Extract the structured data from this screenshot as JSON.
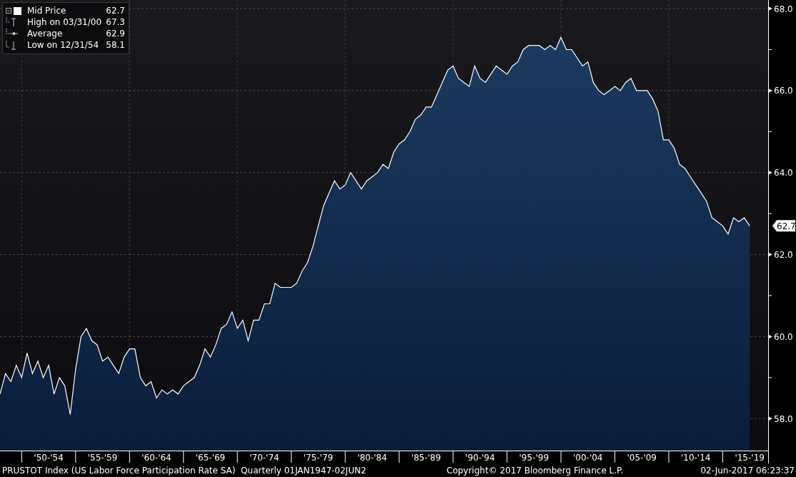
{
  "chart": {
    "legend": [
      {
        "kind": "series",
        "label": "Mid Price",
        "value": "62.7"
      },
      {
        "kind": "high",
        "label": "High on 03/31/00",
        "value": "67.3"
      },
      {
        "kind": "average",
        "label": "Average",
        "value": "62.9"
      },
      {
        "kind": "low",
        "label": "Low on 12/31/54",
        "value": "58.1"
      }
    ],
    "last_value_tag": "62.7",
    "chart_data": {
      "type": "area",
      "grid": true,
      "ylim": [
        57.22,
        68.21
      ],
      "yticks": [
        {
          "value": 58,
          "label": "58.0"
        },
        {
          "value": 60,
          "label": "60.0"
        },
        {
          "value": 62,
          "label": "62.0"
        },
        {
          "value": 64,
          "label": "64.0"
        },
        {
          "value": 66,
          "label": "66.0"
        },
        {
          "value": 68,
          "label": "68.0"
        }
      ],
      "categories": [
        null,
        null,
        null,
        null,
        null,
        null,
        null,
        null,
        null,
        "'50-'54",
        null,
        null,
        null,
        null,
        null,
        null,
        null,
        null,
        null,
        "'55-'59",
        null,
        null,
        null,
        null,
        null,
        null,
        null,
        null,
        null,
        "'60-'64",
        null,
        null,
        null,
        null,
        null,
        null,
        null,
        null,
        null,
        "'65-'69",
        null,
        null,
        null,
        null,
        null,
        null,
        null,
        null,
        null,
        "'70-'74",
        null,
        null,
        null,
        null,
        null,
        null,
        null,
        null,
        null,
        "'75-'79",
        null,
        null,
        null,
        null,
        null,
        null,
        null,
        null,
        null,
        "'80-'84",
        null,
        null,
        null,
        null,
        null,
        null,
        null,
        null,
        null,
        "'85-'89",
        null,
        null,
        null,
        null,
        null,
        null,
        null,
        null,
        null,
        "'90-'94",
        null,
        null,
        null,
        null,
        null,
        null,
        null,
        null,
        null,
        "'95-'99",
        null,
        null,
        null,
        null,
        null,
        null,
        null,
        null,
        null,
        "'00-'04",
        null,
        null,
        null,
        null,
        null,
        null,
        null,
        null,
        null,
        "'05-'09",
        null,
        null,
        null,
        null,
        null,
        null,
        null,
        null,
        null,
        "'10-'14",
        null,
        null,
        null,
        null,
        null,
        null,
        null,
        null,
        null,
        "'15-'19"
      ],
      "series": [
        {
          "color": "#ffffff",
          "values": [
            58.6,
            59.1,
            58.9,
            59.3,
            59.0,
            59.6,
            59.1,
            59.4,
            59.0,
            59.3,
            58.6,
            59.0,
            58.8,
            58.1,
            59.2,
            60.0,
            60.2,
            59.9,
            59.8,
            59.4,
            59.5,
            59.3,
            59.1,
            59.5,
            59.7,
            59.7,
            59.0,
            58.8,
            58.9,
            58.5,
            58.7,
            58.6,
            58.7,
            58.6,
            58.8,
            58.9,
            59.0,
            59.3,
            59.7,
            59.5,
            59.8,
            60.2,
            60.3,
            60.6,
            60.2,
            60.4,
            59.9,
            60.4,
            60.4,
            60.8,
            60.8,
            61.3,
            61.2,
            61.2,
            61.2,
            61.3,
            61.6,
            61.8,
            62.2,
            62.7,
            63.2,
            63.5,
            63.8,
            63.6,
            63.7,
            64.0,
            63.8,
            63.6,
            63.8,
            63.9,
            64.0,
            64.2,
            64.1,
            64.5,
            64.7,
            64.8,
            65.0,
            65.3,
            65.4,
            65.6,
            65.6,
            65.9,
            66.2,
            66.5,
            66.6,
            66.3,
            66.2,
            66.1,
            66.6,
            66.3,
            66.2,
            66.4,
            66.6,
            66.5,
            66.4,
            66.6,
            66.7,
            67.0,
            67.1,
            67.1,
            67.1,
            67.0,
            67.1,
            67.0,
            67.3,
            67.0,
            67.0,
            66.8,
            66.6,
            66.7,
            66.2,
            66.0,
            65.9,
            66.0,
            66.1,
            66.0,
            66.2,
            66.3,
            66.0,
            66.0,
            66.0,
            65.8,
            65.5,
            64.8,
            64.8,
            64.6,
            64.2,
            64.1,
            63.9,
            63.7,
            63.5,
            63.3,
            62.9,
            62.8,
            62.7,
            62.5,
            62.9,
            62.8,
            62.9,
            62.7
          ]
        }
      ]
    }
  },
  "status_bar": {
    "description": "PRUSTOT Index (US Labor Force Participation Rate SA)  Quarterly 01JAN1947-02JUN2",
    "copyright": "Copyright© 2017 Bloomberg Finance L.P.",
    "timestamp": "02-Jun-2017 06:23:37"
  }
}
